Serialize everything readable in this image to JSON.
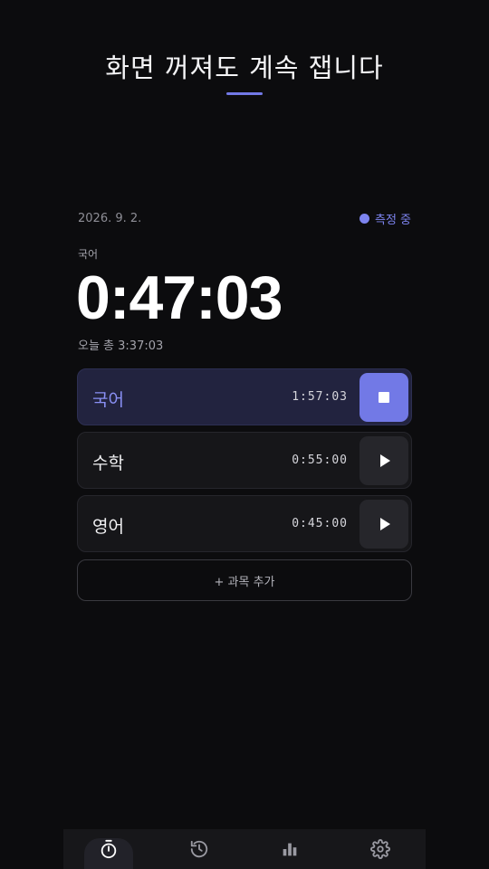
{
  "header": {
    "title": "화면 꺼져도 계속 잽니다"
  },
  "session": {
    "date": "2026. 9. 2.",
    "status": "측정 중",
    "current_subject": "국어",
    "timer": "0:47:03",
    "today_total": "오늘 총 3:37:03"
  },
  "subjects": [
    {
      "name": "국어",
      "time": "1:57:03",
      "active": true,
      "action": "stop"
    },
    {
      "name": "수학",
      "time": "0:55:00",
      "active": false,
      "action": "play"
    },
    {
      "name": "영어",
      "time": "0:45:00",
      "active": false,
      "action": "play"
    }
  ],
  "add_subject_label": "+ 과목 추가",
  "nav": {
    "items": [
      {
        "icon": "stopwatch-icon",
        "active": true
      },
      {
        "icon": "history-icon",
        "active": false
      },
      {
        "icon": "bar-chart-icon",
        "active": false
      },
      {
        "icon": "gear-icon",
        "active": false
      }
    ]
  },
  "colors": {
    "accent": "#7279e6",
    "background": "#0c0c0e",
    "active_row": "#22233f"
  }
}
